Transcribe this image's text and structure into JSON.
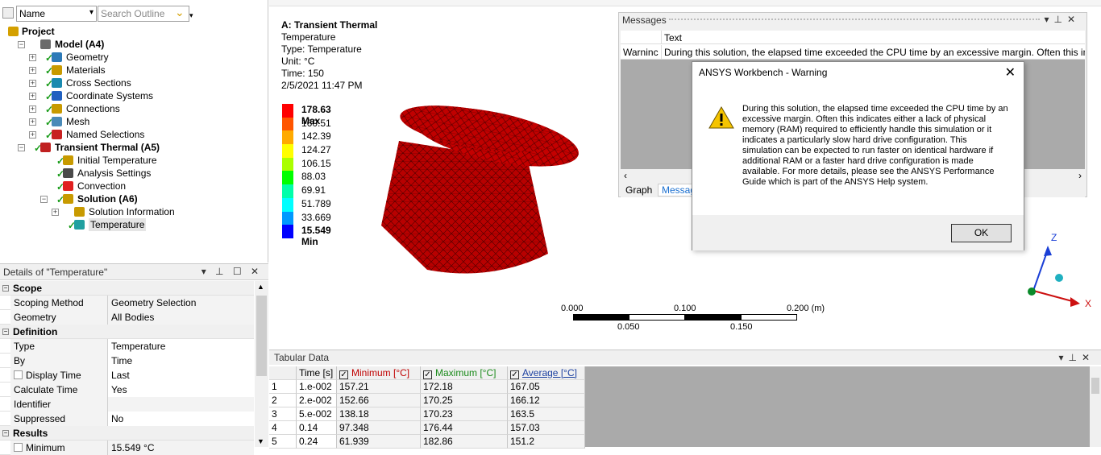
{
  "outline": {
    "filter_label": "Name",
    "search_placeholder": "Search Outline",
    "tree": [
      {
        "label": "Project",
        "bold": true
      },
      {
        "label": "Model (A4)",
        "bold": true
      },
      {
        "label": "Geometry"
      },
      {
        "label": "Materials"
      },
      {
        "label": "Cross Sections"
      },
      {
        "label": "Coordinate Systems"
      },
      {
        "label": "Connections"
      },
      {
        "label": "Mesh"
      },
      {
        "label": "Named Selections"
      },
      {
        "label": "Transient Thermal (A5)",
        "bold": true
      },
      {
        "label": "Initial Temperature"
      },
      {
        "label": "Analysis Settings"
      },
      {
        "label": "Convection"
      },
      {
        "label": "Solution (A6)",
        "bold": true
      },
      {
        "label": "Solution Information"
      },
      {
        "label": "Temperature"
      }
    ]
  },
  "details": {
    "title": "Details of \"Temperature\"",
    "buttons": "▾ 푸 ☐ ✕",
    "sections": [
      {
        "name": "Scope",
        "rows": [
          {
            "k": "Scoping Method",
            "v": "Geometry Selection"
          },
          {
            "k": "Geometry",
            "v": "All Bodies"
          }
        ]
      },
      {
        "name": "Definition",
        "rows": [
          {
            "k": "Type",
            "v": "Temperature"
          },
          {
            "k": "By",
            "v": "Time"
          },
          {
            "k": "Display Time",
            "v": "Last"
          },
          {
            "k": "Calculate Time History",
            "v": "Yes"
          },
          {
            "k": "Identifier",
            "v": ""
          },
          {
            "k": "Suppressed",
            "v": "No"
          }
        ]
      },
      {
        "name": "Results",
        "rows": [
          {
            "k": "Minimum",
            "v": "15.549 °C"
          }
        ]
      }
    ]
  },
  "viewport": {
    "header_title": "A: Transient Thermal",
    "header_lines": [
      "Temperature",
      "Type: Temperature",
      "Unit: °C",
      "Time: 150",
      "2/5/2021 11:47 PM"
    ],
    "legend": [
      {
        "label": "178.63 Max",
        "color": "#ff0000",
        "bold": true
      },
      {
        "label": "160.51",
        "color": "#ff5500"
      },
      {
        "label": "142.39",
        "color": "#ffaa00"
      },
      {
        "label": "124.27",
        "color": "#ffff00"
      },
      {
        "label": "106.15",
        "color": "#aaff00"
      },
      {
        "label": "88.03",
        "color": "#00ff00"
      },
      {
        "label": "69.91",
        "color": "#00ffaa"
      },
      {
        "label": "51.789",
        "color": "#00ffff"
      },
      {
        "label": "33.669",
        "color": "#0099ff"
      },
      {
        "label": "15.549 Min",
        "color": "#0000ff",
        "bold": true
      }
    ],
    "scale": {
      "top": [
        "0.000",
        "0.100",
        "0.200 (m)"
      ],
      "bottom": [
        "0.050",
        "0.150"
      ]
    },
    "axes": {
      "z": "Z",
      "x": "X"
    }
  },
  "messages": {
    "title": "Messages",
    "col_text": "Text",
    "row_type": "Warninc",
    "row_text": "During this solution, the elapsed time exceeded the CPU time by an excessive margin.  Often this inc",
    "tabs": [
      "Graph",
      "Messag"
    ]
  },
  "dialog": {
    "title": "ANSYS Workbench - Warning",
    "body": "During this solution, the elapsed time exceeded the CPU time by an excessive margin.  Often this indicates either a lack of physical memory (RAM) required to efficiently handle this simulation or it indicates a particularly slow hard drive configuration.  This simulation can be expected to run faster on identical hardware if additional RAM or a faster hard drive configuration is made available.  For more details, please see the ANSYS Performance Guide which is part of the ANSYS Help system.",
    "ok": "OK"
  },
  "tabular": {
    "title": "Tabular Data",
    "headers": [
      "Time [s]",
      "Minimum [°C]",
      "Maximum [°C]",
      "Average [°C]"
    ],
    "rows": [
      [
        "1",
        "1.e-002",
        "157.21",
        "172.18",
        "167.05"
      ],
      [
        "2",
        "2.e-002",
        "152.66",
        "170.25",
        "166.12"
      ],
      [
        "3",
        "5.e-002",
        "138.18",
        "170.23",
        "163.5"
      ],
      [
        "4",
        "0.14",
        "97.348",
        "176.44",
        "157.03"
      ],
      [
        "5",
        "0.24",
        "61.939",
        "182.86",
        "151.2"
      ]
    ]
  }
}
